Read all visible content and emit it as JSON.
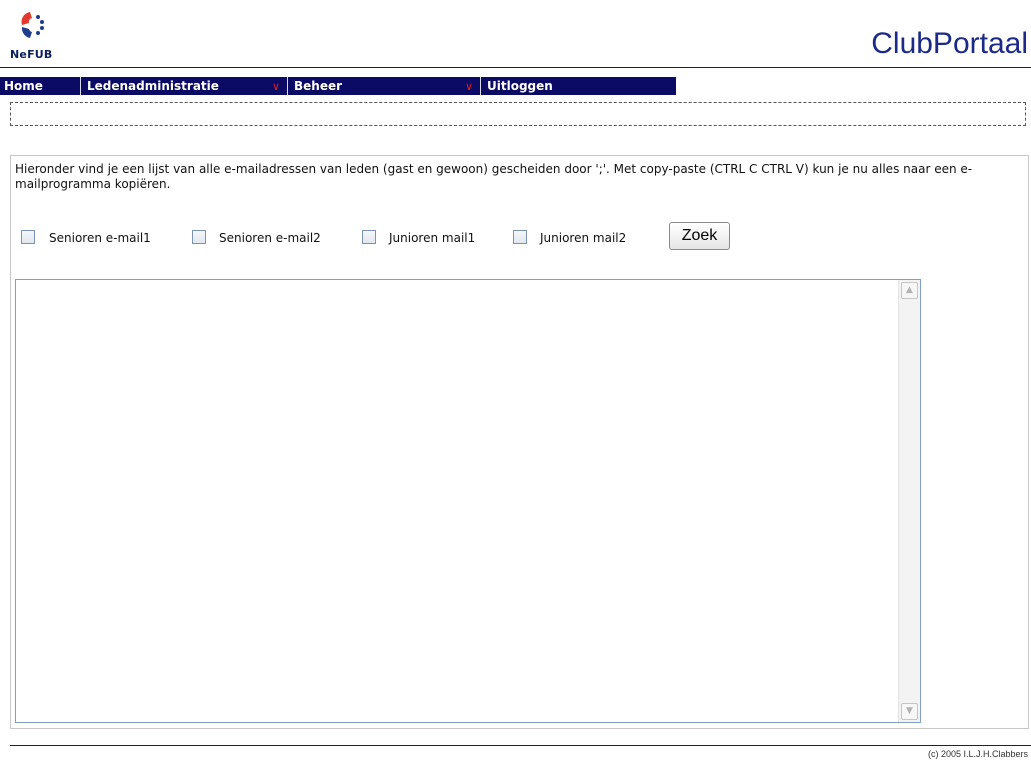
{
  "header": {
    "logo_text": "NeFUB",
    "portal_title": "ClubPortaal"
  },
  "nav": {
    "items": [
      {
        "label": "Home",
        "has_dropdown": false
      },
      {
        "label": "Ledenadministratie",
        "has_dropdown": true
      },
      {
        "label": "Beheer",
        "has_dropdown": true
      },
      {
        "label": "Uitloggen",
        "has_dropdown": false
      }
    ],
    "dropdown_icon": "chevron-down-icon",
    "bar_color": "#0b0b66",
    "caret_color": "#e02020"
  },
  "main": {
    "intro": "Hieronder vind je een lijst van alle e-mailadressen van leden (gast en gewoon) gescheiden door ';'. Met copy-paste (CTRL C CTRL V) kun je nu alles naar een e-mailprogramma kopiëren.",
    "filters": [
      {
        "label": "Senioren e-mail1",
        "checked": false
      },
      {
        "label": "Senioren e-mail2",
        "checked": false
      },
      {
        "label": "Junioren mail1",
        "checked": false
      },
      {
        "label": "Junioren mail2",
        "checked": false
      }
    ],
    "search_button": "Zoek",
    "result_text": ""
  },
  "footer": {
    "copyright": "(c) 2005 I.L.J.H.Clabbers"
  }
}
